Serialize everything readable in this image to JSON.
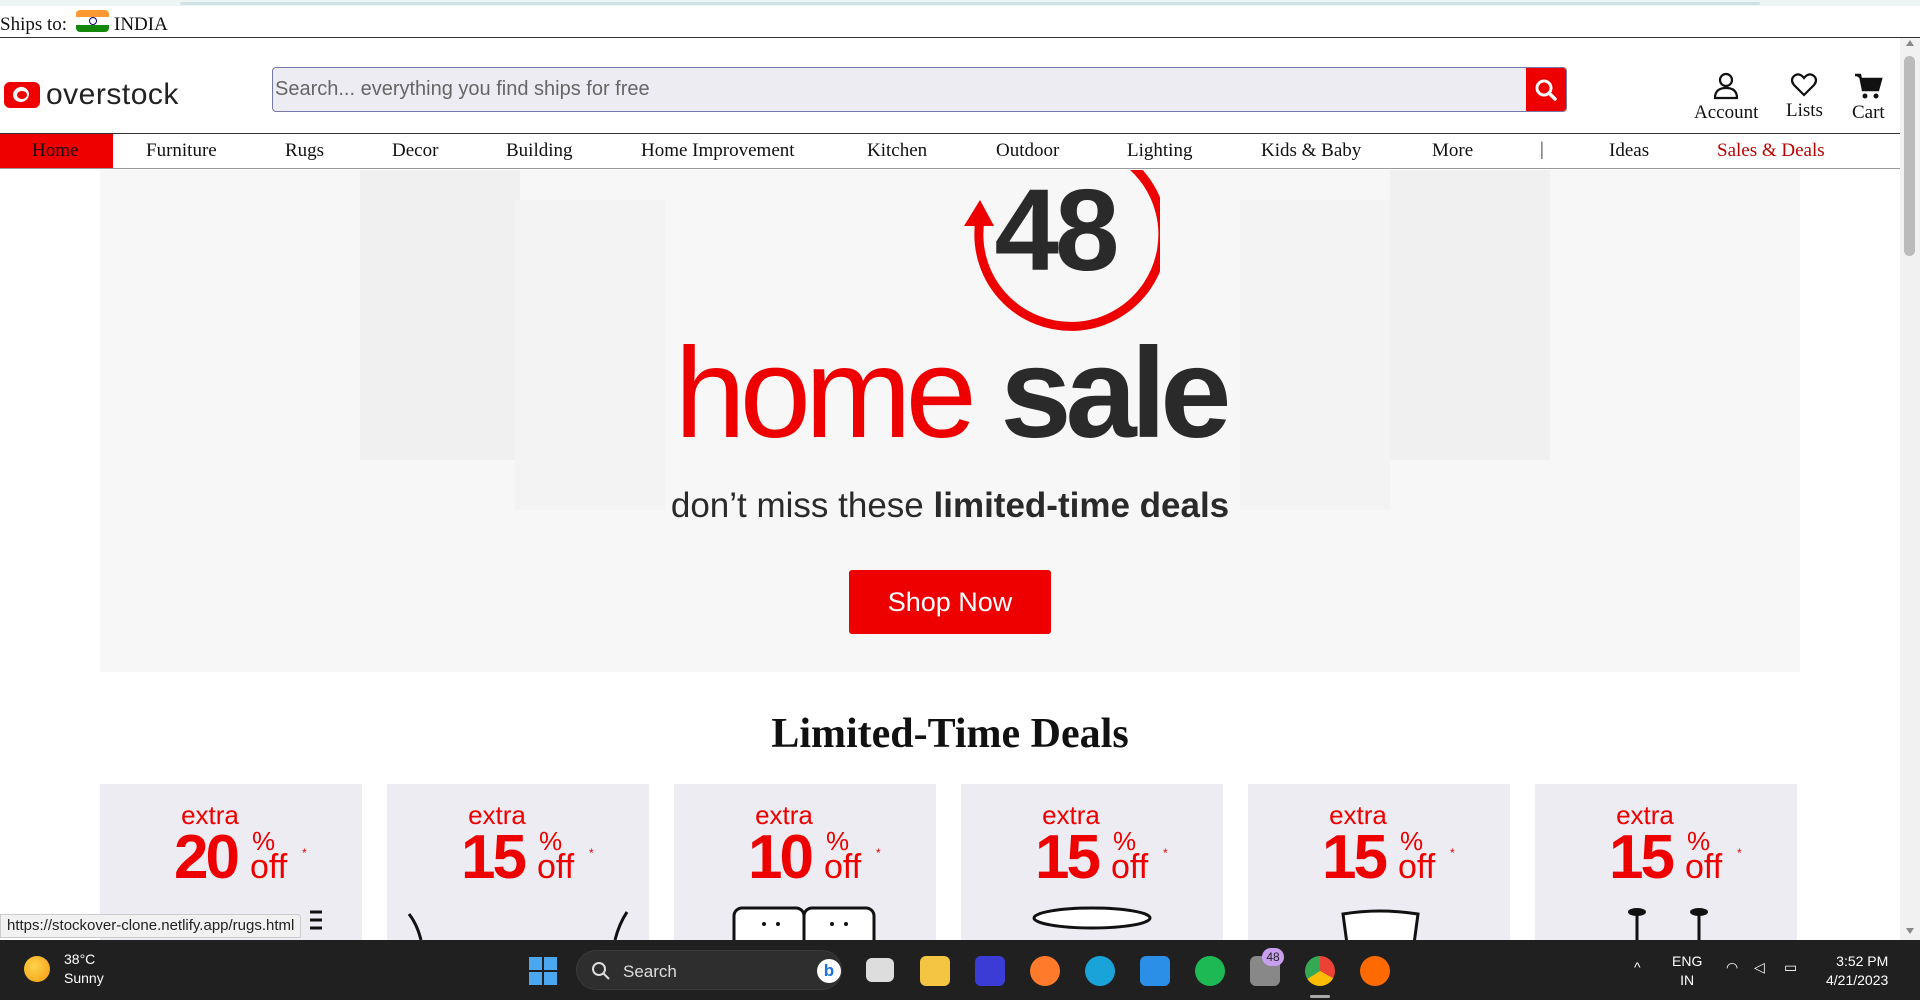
{
  "ships": {
    "label": "Ships to:",
    "country": "INDIA"
  },
  "header": {
    "logo_text": "overstock",
    "search_placeholder": "Search... everything you find ships for free",
    "account_label": "Account",
    "lists_label": "Lists",
    "cart_label": "Cart"
  },
  "nav": {
    "home": "Home",
    "items": [
      "Furniture",
      "Rugs",
      "Decor",
      "Building",
      "Home Improvement",
      "Kitchen",
      "Outdoor",
      "Lighting",
      "Kids & Baby",
      "More"
    ],
    "separator": "|",
    "ideas": "Ideas",
    "sales": "Sales & Deals"
  },
  "hero": {
    "badge_number": "48",
    "title_red": "home",
    "title_dark": "sale",
    "subtitle_plain": "don’t miss these",
    "subtitle_bold": "limited-time deals",
    "cta": "Shop Now"
  },
  "deals_section": {
    "title": "Limited-Time Deals",
    "cards": [
      {
        "extra": "extra",
        "pct": "20",
        "sym": "%",
        "off": "off",
        "ast": "*"
      },
      {
        "extra": "extra",
        "pct": "15",
        "sym": "%",
        "off": "off",
        "ast": "*"
      },
      {
        "extra": "extra",
        "pct": "10",
        "sym": "%",
        "off": "off",
        "ast": "*"
      },
      {
        "extra": "extra",
        "pct": "15",
        "sym": "%",
        "off": "off",
        "ast": "*"
      },
      {
        "extra": "extra",
        "pct": "15",
        "sym": "%",
        "off": "off",
        "ast": "*"
      },
      {
        "extra": "extra",
        "pct": "15",
        "sym": "%",
        "off": "off",
        "ast": "*"
      }
    ]
  },
  "status_url": "https://stockover-clone.netlify.app/rugs.html",
  "taskbar": {
    "temp": "38°C",
    "condition": "Sunny",
    "search_label": "Search",
    "badge": "48",
    "lang_top": "ENG",
    "lang_bottom": "IN",
    "time": "3:52 PM",
    "date": "4/21/2023"
  },
  "colors": {
    "brand_red": "#ee0000",
    "taskbar_bg": "#202020"
  }
}
